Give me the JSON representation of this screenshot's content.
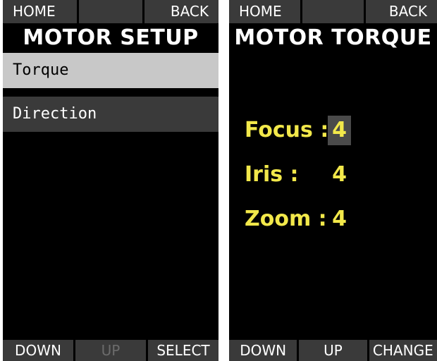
{
  "left_screen": {
    "topbar": {
      "home": "HOME",
      "middle": "",
      "back": "BACK"
    },
    "title": "MOTOR SETUP",
    "menu": [
      {
        "label": "Torque",
        "state": "selected"
      },
      {
        "label": "Direction",
        "state": "normal"
      }
    ],
    "bottombar": {
      "down": "DOWN",
      "up": "UP",
      "select": "SELECT"
    }
  },
  "right_screen": {
    "topbar": {
      "home": "HOME",
      "middle": "",
      "back": "BACK"
    },
    "title": "MOTOR TORQUE",
    "rows": [
      {
        "label": "Focus :",
        "value": "4",
        "highlighted": true
      },
      {
        "label": "Iris :",
        "value": "4",
        "highlighted": false
      },
      {
        "label": "Zoom :",
        "value": "4",
        "highlighted": false
      }
    ],
    "bottombar": {
      "down": "DOWN",
      "up": "UP",
      "change": "CHANGE"
    }
  },
  "colors": {
    "background": "#000000",
    "softkey": "#3a3a3a",
    "selected_item": "#c8c8c8",
    "value_text": "#f2e84a",
    "disabled_text": "#6b6b6b"
  }
}
